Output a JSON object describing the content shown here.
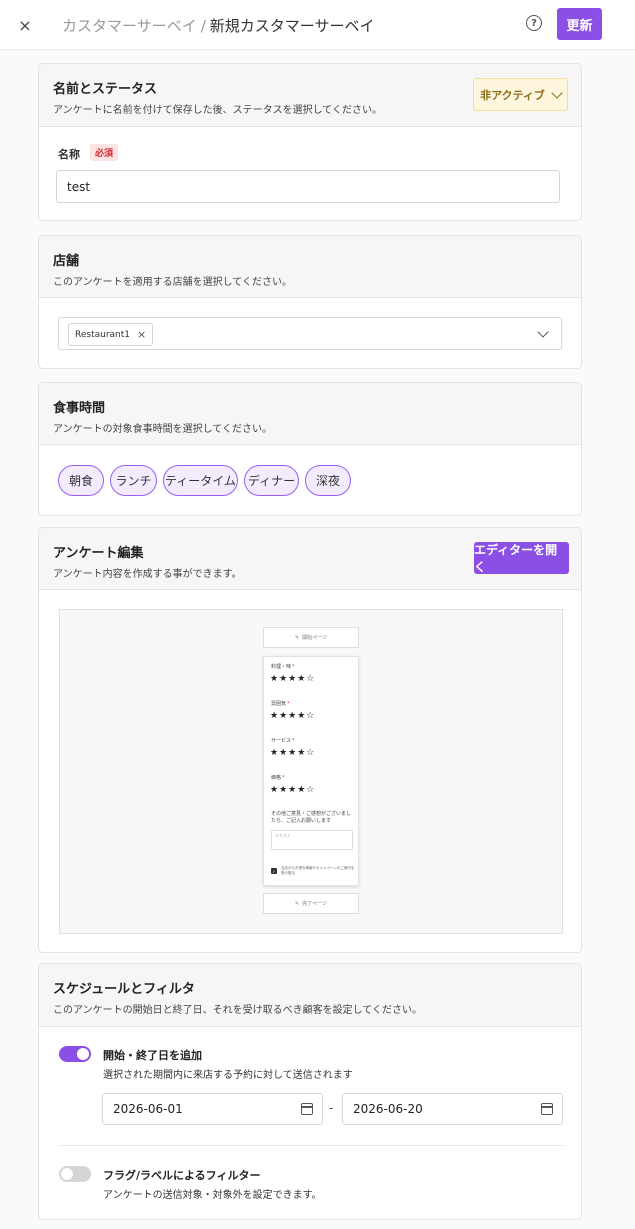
{
  "header": {
    "close_icon": "×",
    "breadcrumb_parent": "カスタマーサーベイ",
    "breadcrumb_sep": "/",
    "breadcrumb_current": "新規カスタマーサーベイ",
    "help_icon": "?",
    "update_label": "更新"
  },
  "name_status": {
    "title": "名前とステータス",
    "subtitle": "アンケートに名前を付けて保存した後、ステータスを選択してください。",
    "status_value": "非アクティブ",
    "status_color": "#fdf6dc",
    "name_label": "名称",
    "required_badge": "必須",
    "name_value": "test"
  },
  "stores": {
    "title": "店舗",
    "subtitle": "このアンケートを適用する店舗を選択してください。",
    "selected_tag": "Restaurant1",
    "tag_remove": "×"
  },
  "meal_times": {
    "title": "食事時間",
    "subtitle": "アンケートの対象食事時間を選択してください。",
    "options": [
      "朝食",
      "ランチ",
      "ティータイム",
      "ディナー",
      "深夜"
    ]
  },
  "survey_edit": {
    "title": "アンケート編集",
    "subtitle": "アンケート内容を作成する事ができます。",
    "open_editor_label": "エディターを開く",
    "preview": {
      "start_page": "開始ページ",
      "end_page": "完了ページ",
      "questions": [
        {
          "label": "料理・味",
          "stars": "★★★★☆"
        },
        {
          "label": "雰囲気",
          "stars": "★★★★☆"
        },
        {
          "label": "サービス",
          "stars": "★★★★☆"
        },
        {
          "label": "価格",
          "stars": "★★★★☆"
        }
      ],
      "required_mark": "*",
      "free_text_label": "その他ご意見・ご感想がございましたら、ご記入お願いします",
      "free_text_placeholder": "テキスト",
      "checkbox_text": "当店からお得な情報やキャンペーンのご案内を受け取る",
      "rating": 4,
      "rating_max": 5
    }
  },
  "schedule": {
    "title": "スケジュールとフィルタ",
    "subtitle": "このアンケートの開始日と終了日、それを受け取るべき顧客を設定してください。",
    "date_toggle_title": "開始・終了日を追加",
    "date_toggle_desc": "選択された期間内に来店する予約に対して送信されます",
    "date_toggle_on": true,
    "start_date": "2026-06-01",
    "date_separator": "-",
    "end_date": "2026-06-20",
    "filter_toggle_title": "フラグ/ラベルによるフィルター",
    "filter_toggle_desc": "アンケートの送信対象・対象外を設定できます。",
    "filter_toggle_on": false
  },
  "colors": {
    "accent": "#8c4fe6",
    "required": "#d12b2b"
  }
}
